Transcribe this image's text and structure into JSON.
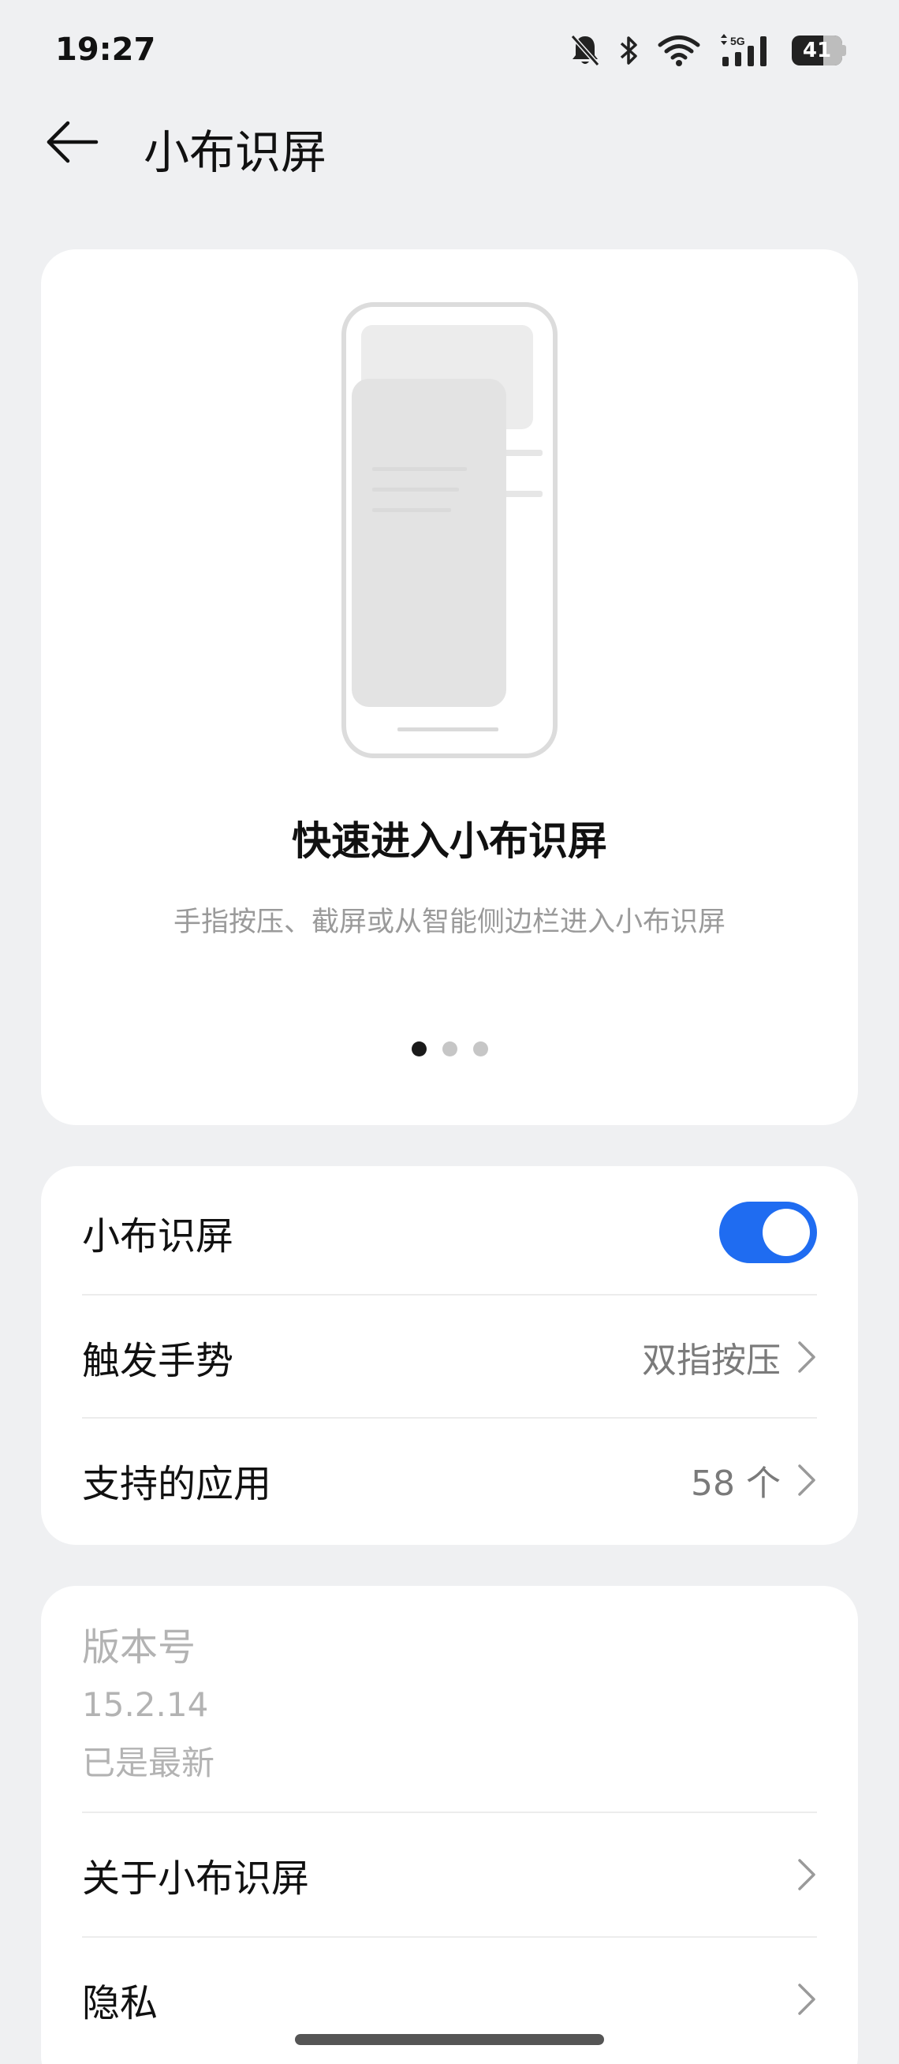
{
  "status_bar": {
    "time": "19:27",
    "battery": "41",
    "network": "5G",
    "icons": [
      "mute-bell-icon",
      "bluetooth-icon",
      "wifi-icon",
      "signal-icon",
      "battery-icon"
    ]
  },
  "header": {
    "title": "小布识屏",
    "back_icon": "arrow-left-icon"
  },
  "hero": {
    "title": "快速进入小布识屏",
    "subtitle": "手指按压、截屏或从智能侧边栏进入小布识屏",
    "page_count": 3,
    "active_page": 1
  },
  "settings": {
    "toggle_row": {
      "label": "小布识屏",
      "enabled": true
    },
    "gesture_row": {
      "label": "触发手势",
      "value": "双指按压"
    },
    "apps_row": {
      "label": "支持的应用",
      "value": "58 个"
    }
  },
  "info": {
    "version_label": "版本号",
    "version_number": "15.2.14",
    "version_status": "已是最新",
    "about_row": {
      "label": "关于小布识屏"
    },
    "privacy_row": {
      "label": "隐私"
    }
  },
  "colors": {
    "accent": "#1f6cf1",
    "background": "#eff0f2",
    "card": "#ffffff"
  }
}
